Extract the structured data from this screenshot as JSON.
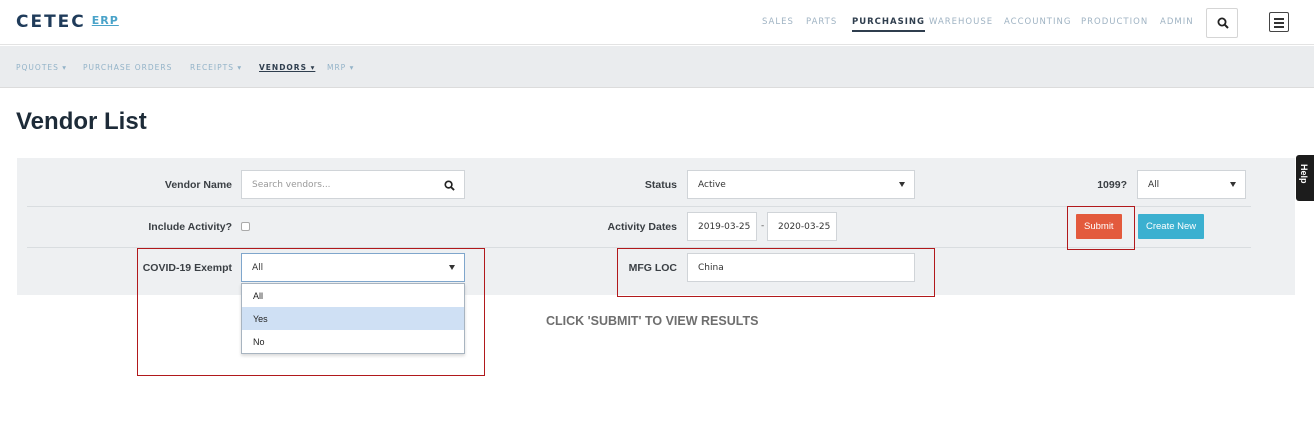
{
  "header": {
    "logo_text": "CETEC",
    "logo_suffix": "ERP",
    "nav": [
      "SALES",
      "PARTS",
      "PURCHASING",
      "WAREHOUSE",
      "ACCOUNTING",
      "PRODUCTION",
      "ADMIN"
    ],
    "active_nav": "PURCHASING",
    "icons": [
      "search-icon",
      "hamburger-menu-icon"
    ]
  },
  "subnav": {
    "items": [
      "PQUOTES ▾",
      "PURCHASE ORDERS",
      "RECEIPTS ▾",
      "VENDORS ▾",
      "MRP ▾"
    ],
    "active": "VENDORS ▾"
  },
  "page": {
    "title": "Vendor List"
  },
  "filters": {
    "vendor_name_label": "Vendor Name",
    "vendor_name_placeholder": "Search vendors...",
    "status_label": "Status",
    "status_value": "Active",
    "form1099_label": "1099?",
    "form1099_value": "All",
    "include_activity_label": "Include Activity?",
    "activity_dates_label": "Activity Dates",
    "date_from": "2019-03-25",
    "date_separator": "-",
    "date_to": "2020-03-25",
    "covid_label": "COVID-19 Exempt",
    "covid_value": "All",
    "covid_options": [
      "All",
      "Yes",
      "No"
    ],
    "covid_highlighted": "Yes",
    "mfg_loc_label": "MFG LOC",
    "mfg_loc_value": "China"
  },
  "buttons": {
    "submit": "Submit",
    "create_new": "Create New"
  },
  "hint": "CLICK 'SUBMIT' TO VIEW RESULTS",
  "help_tab": "Help",
  "colors": {
    "submit": "#e35a3d",
    "create_new": "#3bb0d0",
    "annotation_box": "#b1191c",
    "highlight_option": "#cfe0f4"
  }
}
